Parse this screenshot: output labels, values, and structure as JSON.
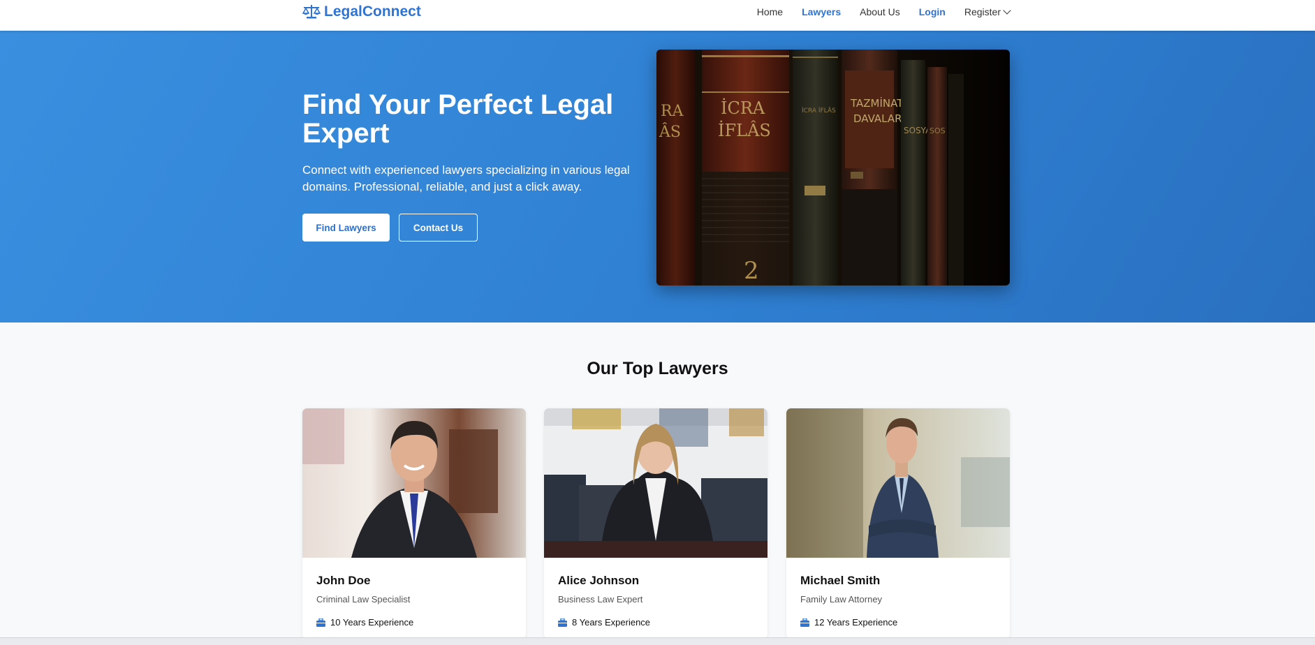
{
  "brand": {
    "name": "LegalConnect",
    "icon": "scales-icon",
    "color": "#2f74d0"
  },
  "nav": {
    "items": [
      {
        "label": "Home",
        "active": false
      },
      {
        "label": "Lawyers",
        "active": true
      },
      {
        "label": "About Us",
        "active": false
      },
      {
        "label": "Login",
        "active": false
      },
      {
        "label": "Register",
        "active": false
      }
    ]
  },
  "hero": {
    "title": "Find Your Perfect Legal Expert",
    "subtitle": "Connect with experienced lawyers specializing in various legal domains. Professional, reliable, and just a click away.",
    "primary_button": "Find Lawyers",
    "secondary_button": "Contact Us",
    "background": "#3088d8"
  },
  "lawyers_section": {
    "title": "Our Top Lawyers",
    "cards": [
      {
        "name": "John Doe",
        "specialty": "Criminal Law Specialist",
        "experience": "10 Years Experience"
      },
      {
        "name": "Alice Johnson",
        "specialty": "Business Law Expert",
        "experience": "8 Years Experience"
      },
      {
        "name": "Michael Smith",
        "specialty": "Family Law Attorney",
        "experience": "12 Years Experience"
      }
    ]
  }
}
